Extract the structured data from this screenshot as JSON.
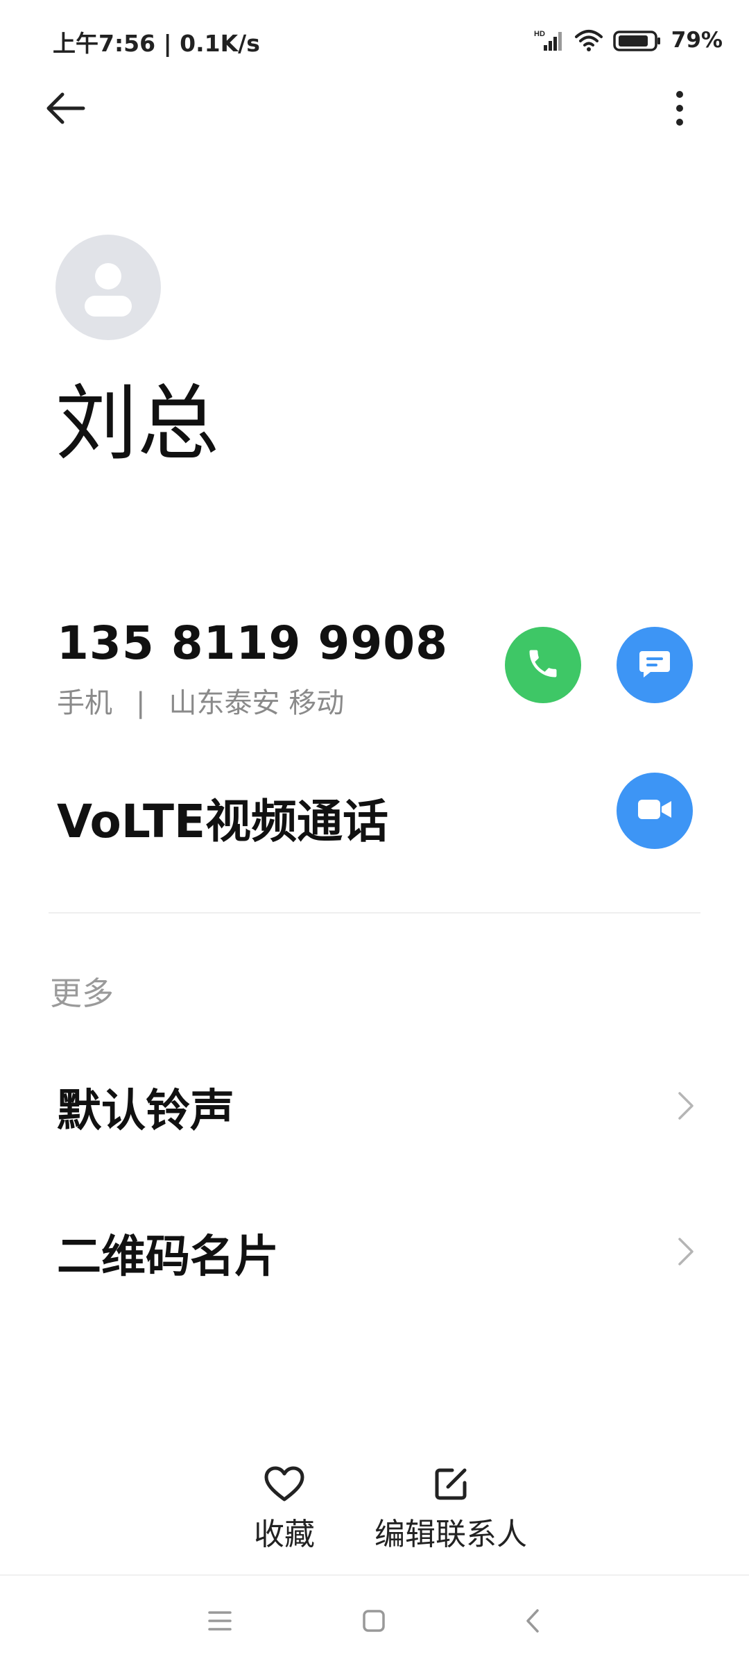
{
  "status_bar": {
    "time_speed": "上午7:56 | 0.1K/s",
    "battery": "79%",
    "icons": [
      "hd-signal-icon",
      "wifi-icon",
      "battery-icon"
    ]
  },
  "contact": {
    "name": "刘总",
    "phone": {
      "number": "135 8119 9908",
      "type": "手机",
      "separator": "|",
      "location": "山东泰安 移动"
    },
    "volte_label": "VoLTE视频通话"
  },
  "more": {
    "section_label": "更多",
    "items": [
      {
        "label": "默认铃声"
      },
      {
        "label": "二维码名片"
      }
    ]
  },
  "bottom_actions": {
    "favorite": "收藏",
    "edit": "编辑联系人"
  },
  "colors": {
    "call": "#3ec766",
    "message": "#3d95f5",
    "video": "#3d95f5",
    "avatar_bg": "#e1e3e8"
  }
}
